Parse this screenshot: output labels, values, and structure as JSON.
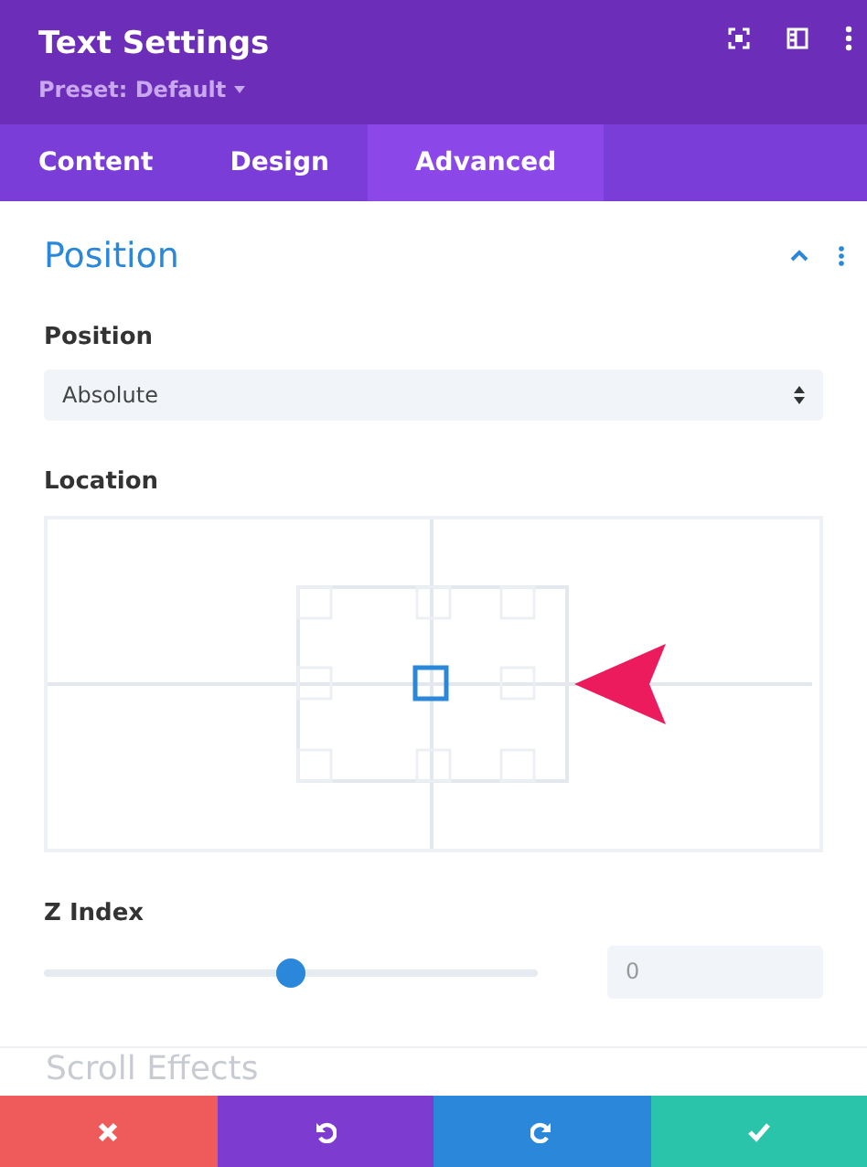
{
  "header": {
    "title": "Text Settings",
    "preset": "Preset: Default"
  },
  "tabs": [
    {
      "label": "Content",
      "selected": false
    },
    {
      "label": "Design",
      "selected": false
    },
    {
      "label": "Advanced",
      "selected": true
    }
  ],
  "section": {
    "title": "Position",
    "expanded": true
  },
  "position_field": {
    "label": "Position",
    "value": "Absolute"
  },
  "location": {
    "label": "Location",
    "positions": [
      {
        "selected": false
      },
      {
        "selected": false
      },
      {
        "selected": false
      },
      {
        "selected": false
      },
      {
        "selected": true
      },
      {
        "selected": false
      },
      {
        "selected": false
      },
      {
        "selected": false
      },
      {
        "selected": false
      }
    ]
  },
  "z_index": {
    "label": "Z Index",
    "level": 0.5,
    "value": "0"
  },
  "next_section": {
    "title": "Scroll Effects"
  },
  "footer_buttons": [
    {
      "kind": "discard"
    },
    {
      "kind": "undo"
    },
    {
      "kind": "redo"
    },
    {
      "kind": "save"
    }
  ]
}
